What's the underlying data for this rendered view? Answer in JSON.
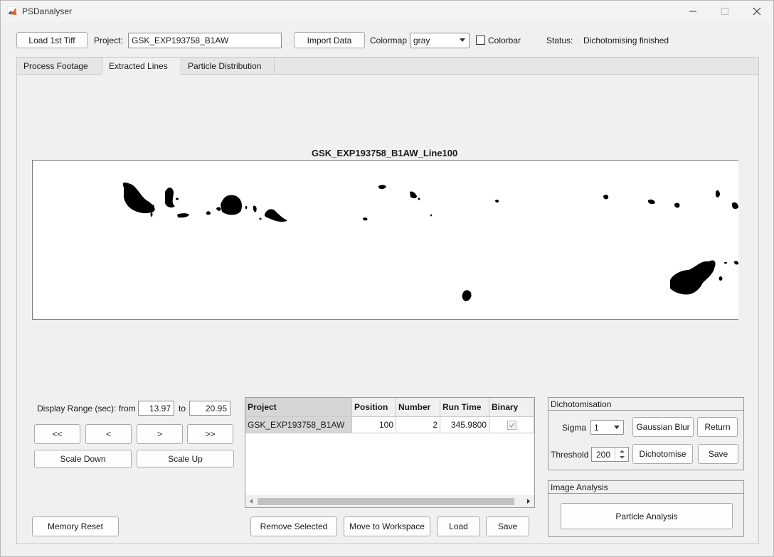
{
  "window": {
    "title": "PSDanalyser"
  },
  "toolbar": {
    "load_tiff": "Load 1st Tiff",
    "project_label": "Project:",
    "project_value": "GSK_EXP193758_B1AW",
    "import_data": "Import Data",
    "colormap_label": "Colormap",
    "colormap_value": "gray",
    "colorbar_label": "Colorbar",
    "colorbar_checked": false,
    "status_label": "Status:",
    "status_value": "Dichotomising finished"
  },
  "tabs": [
    {
      "label": "Process Footage",
      "active": false
    },
    {
      "label": "Extracted Lines",
      "active": true
    },
    {
      "label": "Particle Distribution",
      "active": false
    }
  ],
  "axes": {
    "title": "GSK_EXP193758_B1AW_Line100"
  },
  "display_range": {
    "label": "Display Range (sec): from",
    "from": "13.97",
    "to_label": "to",
    "to": "20.95",
    "nav": [
      "<<",
      "<",
      ">",
      ">>"
    ],
    "scale_down": "Scale Down",
    "scale_up": "Scale Up"
  },
  "table": {
    "columns": [
      "Project",
      "Position",
      "Number",
      "Run Time",
      "Binary"
    ],
    "rows": [
      {
        "project": "GSK_EXP193758_B1AW",
        "position": "100",
        "number": "2",
        "run_time": "345.9800",
        "binary": true
      }
    ]
  },
  "buttons": {
    "memory_reset": "Memory Reset",
    "remove_selected": "Remove Selected",
    "move_to_workspace": "Move to Workspace",
    "load": "Load",
    "save": "Save"
  },
  "dichotomisation": {
    "title": "Dichotomisation",
    "sigma_label": "Sigma",
    "sigma_value": "1",
    "gaussian_blur": "Gaussian Blur",
    "return": "Return",
    "threshold_label": "Threshold",
    "threshold_value": "200",
    "dichotomise": "Dichotomise",
    "save": "Save"
  },
  "image_analysis": {
    "title": "Image Analysis",
    "particle_analysis": "Particle Analysis"
  },
  "icons": {
    "app": "matlab-icon",
    "minimize": "minimize-icon",
    "maximize": "maximize-icon",
    "close": "close-icon"
  }
}
